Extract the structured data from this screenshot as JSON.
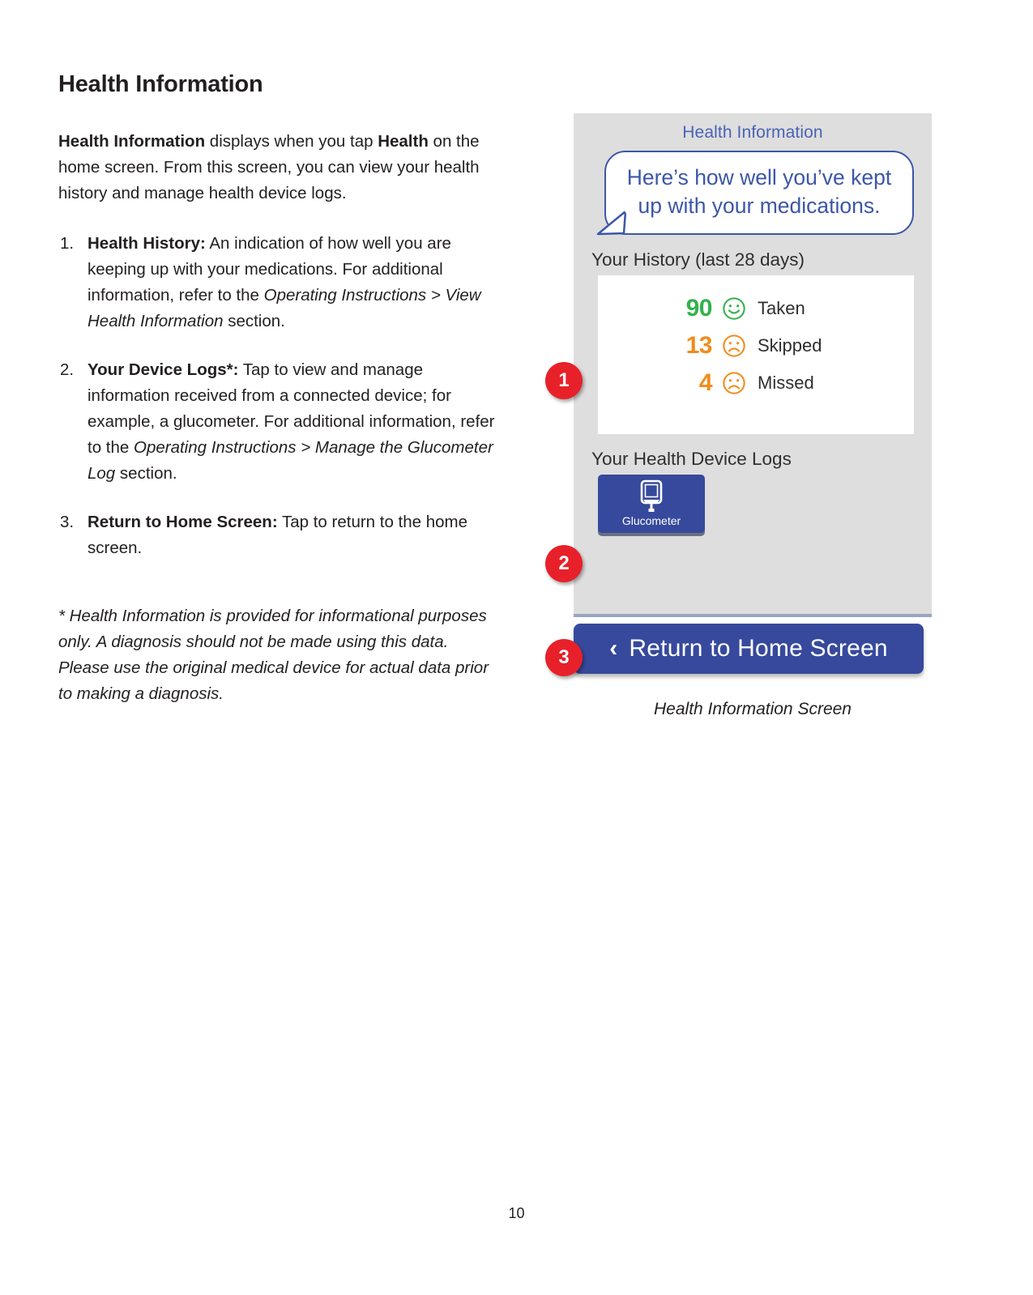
{
  "document": {
    "heading": "Health Information",
    "intro": {
      "bold_lead": "Health Information",
      "text_1": " displays when you tap ",
      "bold_2": "Health",
      "text_2": " on the home screen. From this screen, you can view your health history and manage health device logs."
    },
    "list": [
      {
        "number": "1.",
        "term": "Health History:",
        "body_1": " An indication of how well you are keeping up with your medications.  For additional information, refer to the ",
        "italic": "Operating Instructions > View Health Information",
        "body_2": " section."
      },
      {
        "number": "2.",
        "term": "Your Device Logs*:",
        "body_1": " Tap to view and manage information received from a connected device; for example, a glucometer. For additional information, refer to the ",
        "italic": "Operating Instructions > Manage the Glucometer Log",
        "body_2": " section."
      },
      {
        "number": "3.",
        "term": "Return to Home Screen:",
        "body_1": " Tap to return to the home screen.",
        "italic": "",
        "body_2": ""
      }
    ],
    "footnote": "* Health Information is provided for informational purposes only.  A diagnosis should not be made using this data.  Please use the original medical device for actual data prior to making a diagnosis.",
    "page_number": "10"
  },
  "mockup": {
    "title": "Health Information",
    "bubble_text": "Here’s how well you’ve kept up with your medications.",
    "history_label": "Your History (last 28 days)",
    "history": [
      {
        "count": "90",
        "face": "smiley-face-icon",
        "label": "Taken",
        "color": "#33b24b"
      },
      {
        "count": "13",
        "face": "frowny-face-icon",
        "label": "Skipped",
        "color": "#f08c1c"
      },
      {
        "count": "4",
        "face": "frowny-face-icon",
        "label": "Missed",
        "color": "#f08c1c"
      }
    ],
    "device_logs_label": "Your Health Device Logs",
    "glucometer_label": "Glucometer",
    "return_button_label": "Return to Home Screen",
    "return_button_chevron": "‹",
    "caption": "Health Information Screen",
    "colors": {
      "panel_background": "#dedede",
      "title_blue": "#4a63b5",
      "button_blue": "#36499c",
      "bubble_border": "#3c57a6",
      "badge_red": "#e8202a",
      "taken_green": "#33b24b",
      "warning_orange": "#f08c1c"
    }
  },
  "callouts": [
    {
      "number": "1",
      "target": "history-card"
    },
    {
      "number": "2",
      "target": "glucometer-button"
    },
    {
      "number": "3",
      "target": "return-home-button"
    }
  ]
}
